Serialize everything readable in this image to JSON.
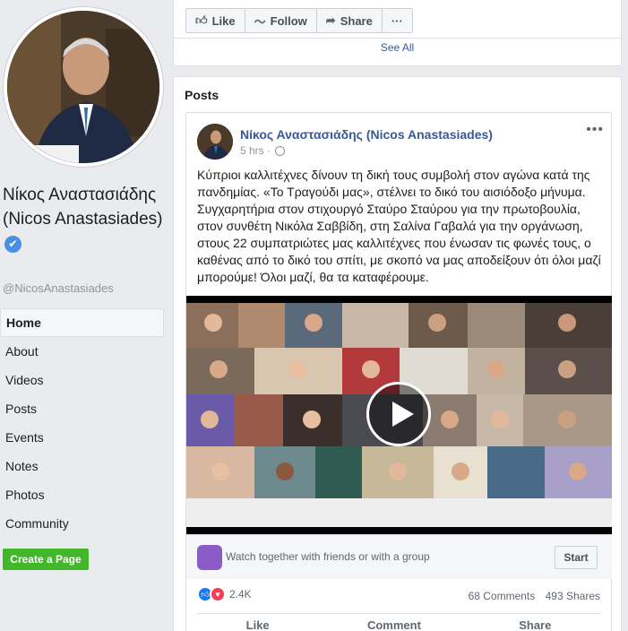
{
  "profile": {
    "name": "Νίκος Αναστασιάδης (Nicos Anastasiades)",
    "verified_glyph": "✔",
    "handle": "@NicosAnastasiades"
  },
  "nav": {
    "items": [
      {
        "label": "Home",
        "active": true
      },
      {
        "label": "About"
      },
      {
        "label": "Videos"
      },
      {
        "label": "Posts"
      },
      {
        "label": "Events"
      },
      {
        "label": "Notes"
      },
      {
        "label": "Photos"
      },
      {
        "label": "Community"
      }
    ],
    "create_page": "Create a Page"
  },
  "toolbar": {
    "like": "Like",
    "follow": "Follow",
    "share": "Share",
    "more": "···",
    "like_icon": "thumbs-up-icon",
    "follow_icon": "rss-icon",
    "share_icon": "share-arrow-icon"
  },
  "see_all": "See All",
  "posts": {
    "title": "Posts",
    "post": {
      "author": "Νίκος Αναστασιάδης (Nicos Anastasiades)",
      "time": "5 hrs",
      "text": "Κύπριοι καλλιτέχνες δίνουν τη δική τους συμβολή στον αγώνα κατά της πανδημίας. «Το Τραγούδι μας», στέλνει το δικό του αισιόδοξο μήνυμα. Συγχαρητήρια στον στιχουργό Σταύρο Σταύρου για την πρωτοβουλία, στον συνθέτη Νικόλα Σαββίδη, στη Σαλίνα Γαβαλά για την οργάνωση, στους 22 συμπατριώτες μας καλλιτέχνες που ένωσαν τις φωνές τους, ο καθένας από το δικό του σπίτι, με σκοπό να μας αποδείξουν ότι όλοι μαζί μπορούμε! Όλοι μαζί, θα τα καταφέρουμε.",
      "watch_text": "Watch together with friends or with a group",
      "start": "Start",
      "reactions": "2.4K",
      "comments": "68 Comments",
      "shares": "493 Shares",
      "actions": {
        "like": "Like",
        "comment": "Comment",
        "share": "Share"
      }
    }
  },
  "colors": {
    "link": "#385898",
    "create_page": "#42b72a",
    "like_reaction": "#1877f2",
    "love_reaction": "#f33e58",
    "watch_icon": "#8b5cc7"
  }
}
